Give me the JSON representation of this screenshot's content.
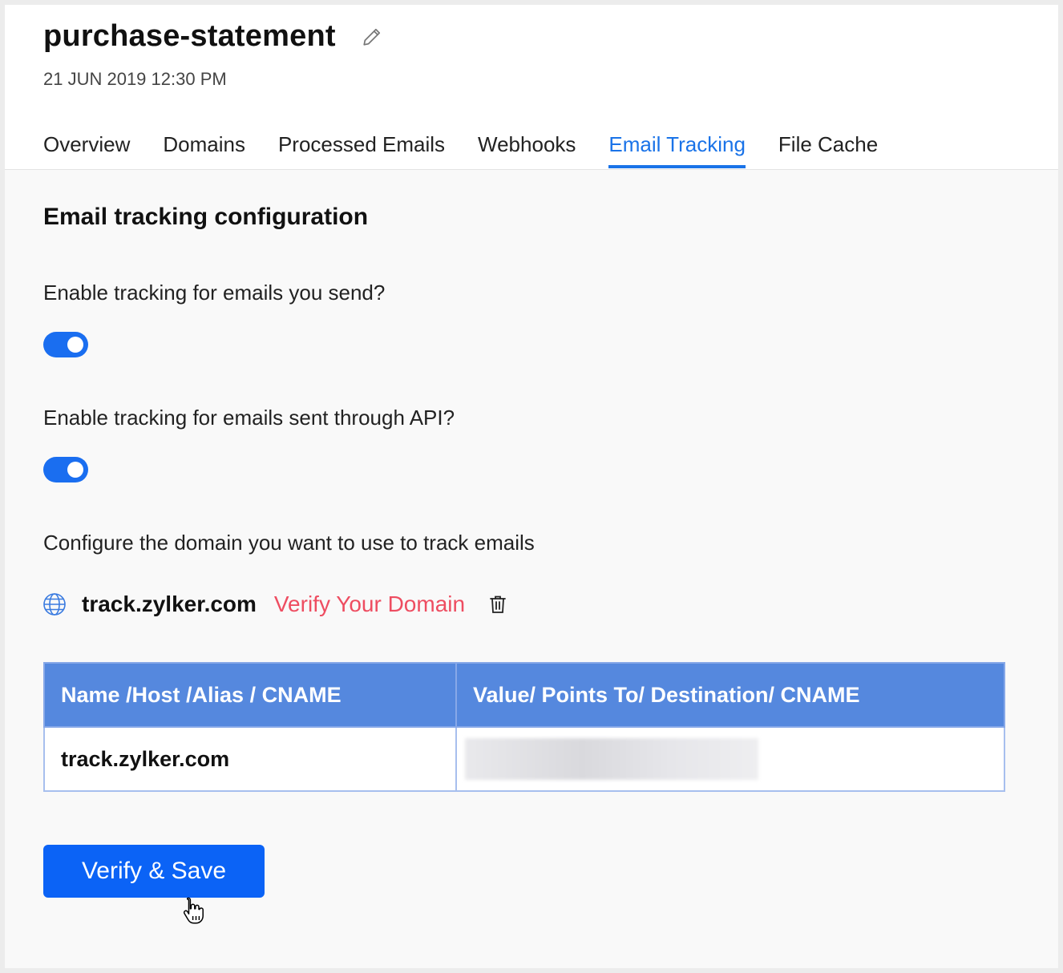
{
  "header": {
    "title": "purchase-statement",
    "datetime": "21 JUN 2019 12:30 PM"
  },
  "tabs": [
    {
      "label": "Overview",
      "active": false
    },
    {
      "label": "Domains",
      "active": false
    },
    {
      "label": "Processed Emails",
      "active": false
    },
    {
      "label": "Webhooks",
      "active": false
    },
    {
      "label": "Email Tracking",
      "active": true
    },
    {
      "label": "File Cache",
      "active": false
    }
  ],
  "config": {
    "section_title": "Email tracking configuration",
    "question_send": "Enable tracking for emails you send?",
    "toggle_send_on": true,
    "question_api": "Enable tracking for emails sent through API?",
    "toggle_api_on": true,
    "domain_prompt": "Configure the domain you want to use to track emails"
  },
  "domain": {
    "name": "track.zylker.com",
    "verify_label": "Verify Your Domain"
  },
  "dns_table": {
    "headers": [
      "Name /Host /Alias / CNAME",
      "Value/ Points To/ Destination/ CNAME"
    ],
    "rows": [
      [
        "track.zylker.com",
        ""
      ]
    ]
  },
  "actions": {
    "save_label": "Verify & Save"
  },
  "colors": {
    "accent": "#1a73e8",
    "verify_link": "#ee4d61",
    "table_header": "#5588de",
    "button": "#0b63f6"
  }
}
